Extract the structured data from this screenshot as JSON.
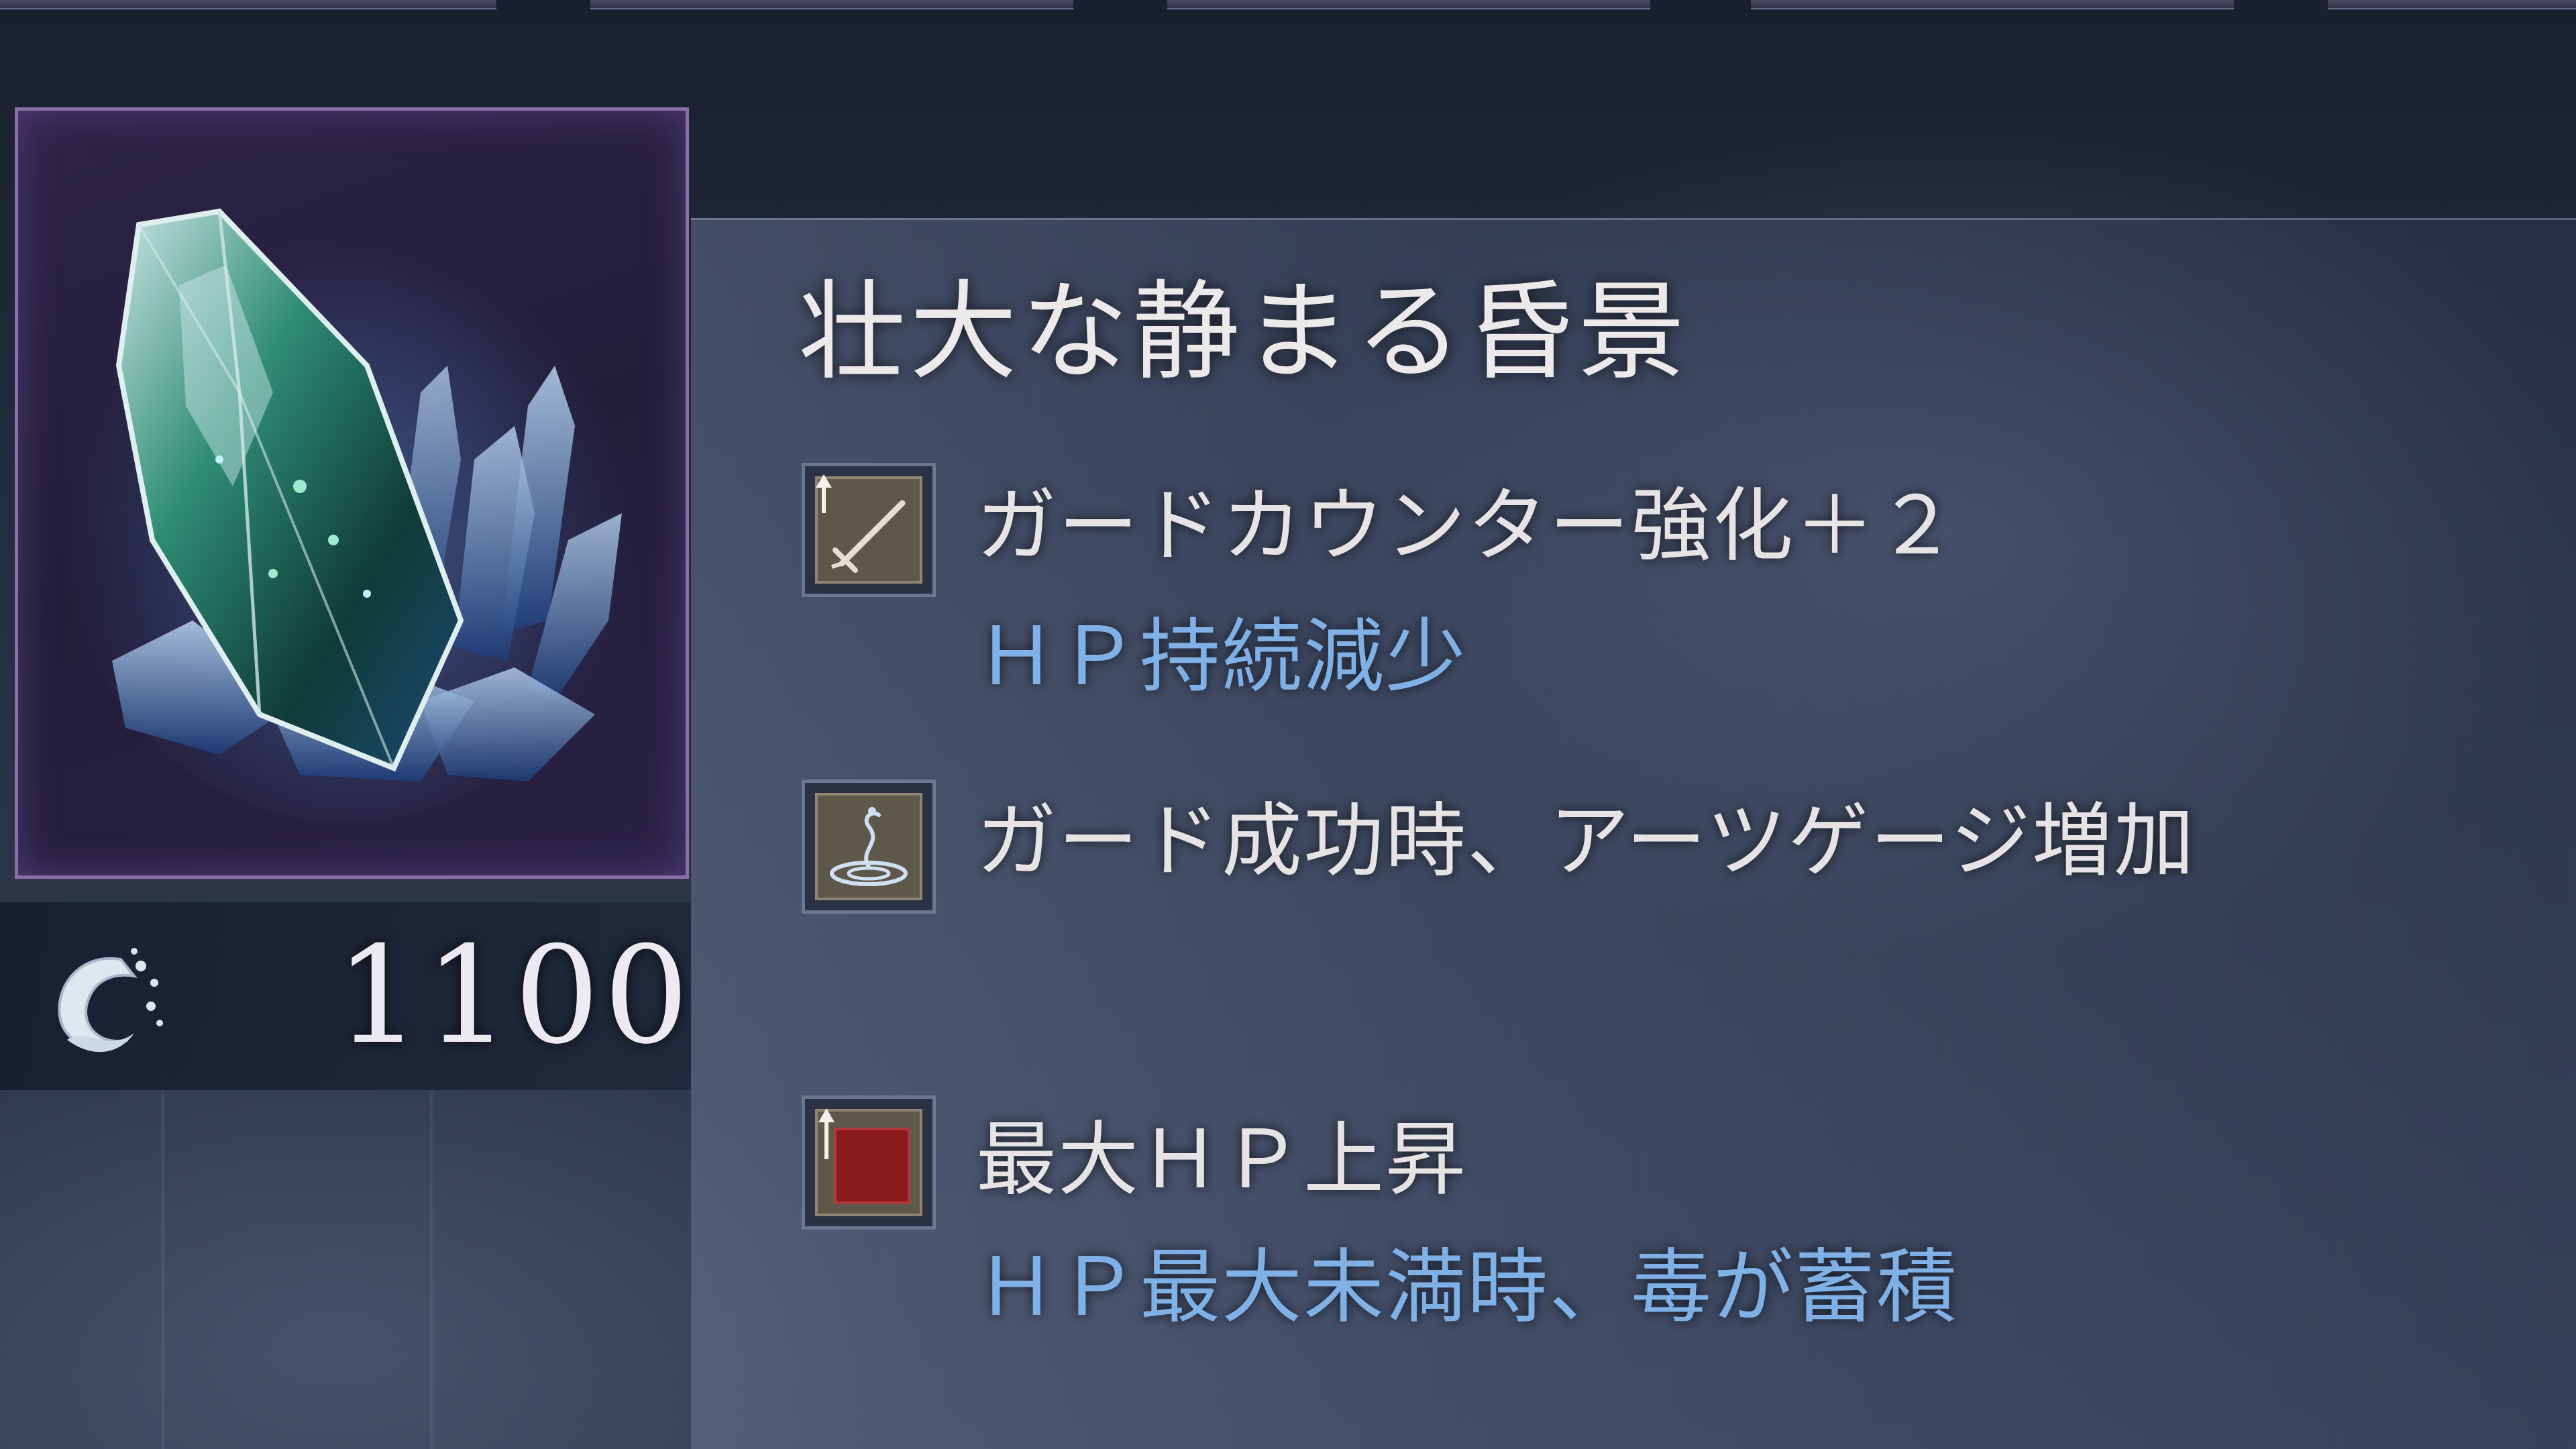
{
  "item": {
    "name": "壮大な静まる昏景",
    "price": "1100",
    "icon": "crystal-gem-icon"
  },
  "currency": {
    "icon": "wave-coin-icon"
  },
  "effects": [
    {
      "icon": "sword-up-icon",
      "main": "ガードカウンター強化＋２",
      "sub": "ＨＰ持続減少"
    },
    {
      "icon": "water-spirit-icon",
      "main": "ガード成功時、アーツゲージ増加",
      "sub": ""
    },
    {
      "icon": "red-block-up-icon",
      "main": "最大ＨＰ上昇",
      "sub": "ＨＰ最大未満時、毒が蓄積"
    }
  ],
  "colors": {
    "text_main": "#e6e3e4",
    "text_sub": "#7fb0e6",
    "frame": "#8a6fa8"
  }
}
